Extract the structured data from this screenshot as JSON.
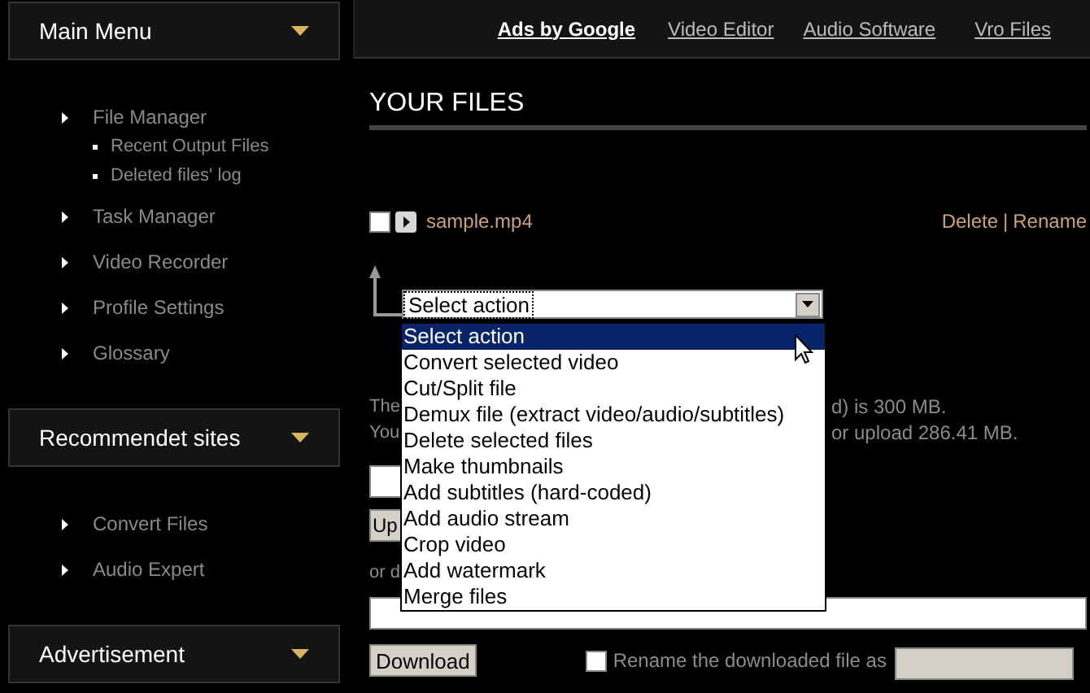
{
  "sidebar": {
    "sections": [
      {
        "title": "Main Menu",
        "items": [
          {
            "label": "File Manager",
            "children": [
              {
                "label": "Recent Output Files"
              },
              {
                "label": "Deleted files' log"
              }
            ]
          },
          {
            "label": "Task Manager"
          },
          {
            "label": "Video Recorder"
          },
          {
            "label": "Profile Settings"
          },
          {
            "label": "Glossary"
          }
        ]
      },
      {
        "title": "Recommendet sites",
        "items": [
          {
            "label": "Convert Files"
          },
          {
            "label": "Audio Expert"
          }
        ]
      },
      {
        "title": "Advertisement"
      }
    ]
  },
  "top_bar": {
    "heading": "Ads by Google",
    "links": [
      "Video Editor",
      "Audio Software",
      "Vro Files"
    ]
  },
  "page_title": "YOUR FILES",
  "files": [
    {
      "name": "sample.mp4",
      "checked": false
    }
  ],
  "file_actions": {
    "links": [
      "Delete",
      "Rename"
    ],
    "separator": "|"
  },
  "action_select": {
    "value": "Select action",
    "expanded": true,
    "options": [
      {
        "label": "Select action",
        "selected": true
      },
      {
        "label": "Convert selected video",
        "selected": false
      },
      {
        "label": "Cut/Split file",
        "selected": false
      },
      {
        "label": "Demux file (extract video/audio/subtitles)",
        "selected": false
      },
      {
        "label": "Delete selected files",
        "selected": false
      },
      {
        "label": "Make thumbnails",
        "selected": false
      },
      {
        "label": "Add subtitles (hard-coded)",
        "selected": false
      },
      {
        "label": "Add audio stream",
        "selected": false
      },
      {
        "label": "Crop video",
        "selected": false
      },
      {
        "label": "Add watermark",
        "selected": false
      },
      {
        "label": "Merge files",
        "selected": false
      }
    ]
  },
  "info_lines": [
    {
      "left": "The",
      "right": "d) is 300 MB."
    },
    {
      "left": "You",
      "right": "or upload 286.41 MB."
    }
  ],
  "upload_button": "Up",
  "or_text": "or d",
  "download_button": "Download",
  "rename": {
    "label": "Rename the downloaded file as",
    "checked": false
  }
}
